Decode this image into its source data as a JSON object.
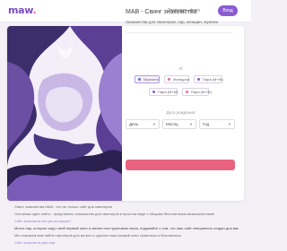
{
  "header": {
    "logo": "maw",
    "logo_dot": ".",
    "link": "Загрузить фото",
    "login": "Вход"
  },
  "card": {
    "title": "MAB - Свинг знакомства",
    "subtitle": "Знакомства для свингеров, пар, женщин, мужчин",
    "i_am_label": "Я:",
    "gender_options": [
      {
        "label": "Мужчина",
        "icon_color": "#4a7bd6",
        "active": true
      },
      {
        "label": "Женщина",
        "icon_color": "#e36d9c",
        "active": false
      },
      {
        "label": "Пара (М+Ж)",
        "icon_color": "#8b5bd2",
        "active": false
      }
    ],
    "extra_options": [
      {
        "label": "Пара (М+М)",
        "icon_color": "#8b5bd2",
        "active": false
      },
      {
        "label": "Пара (Ж+Ж)",
        "icon_color": "#e36d9c",
        "active": false
      }
    ],
    "birth_label": "Дата рождения:",
    "birth_selects": [
      {
        "value": "День"
      },
      {
        "value": "Месяц"
      },
      {
        "value": "Год"
      }
    ],
    "submit_color": "#e9637f"
  },
  "intro": {
    "line1": "Свинг знакомства MAB - это не только сайт для свингеров",
    "line2": "Основная идея сайта - представить знакомства для свингеров в простом виде с общими бесплатными возможностями!",
    "line3": "Сайт знакомств без регистрации?",
    "line4": "Много пар, которые ищут свой первый опыт в свинге или групповом сексе, подумайте о том, что наш сайт специально создан для вас, для пар в поиске",
    "line5": "Мы поможем вам найти партнеров для встреч и сделать ваш первый опыт приятным и безопасным",
    "line6": "Сайт знакомств для пар:"
  }
}
